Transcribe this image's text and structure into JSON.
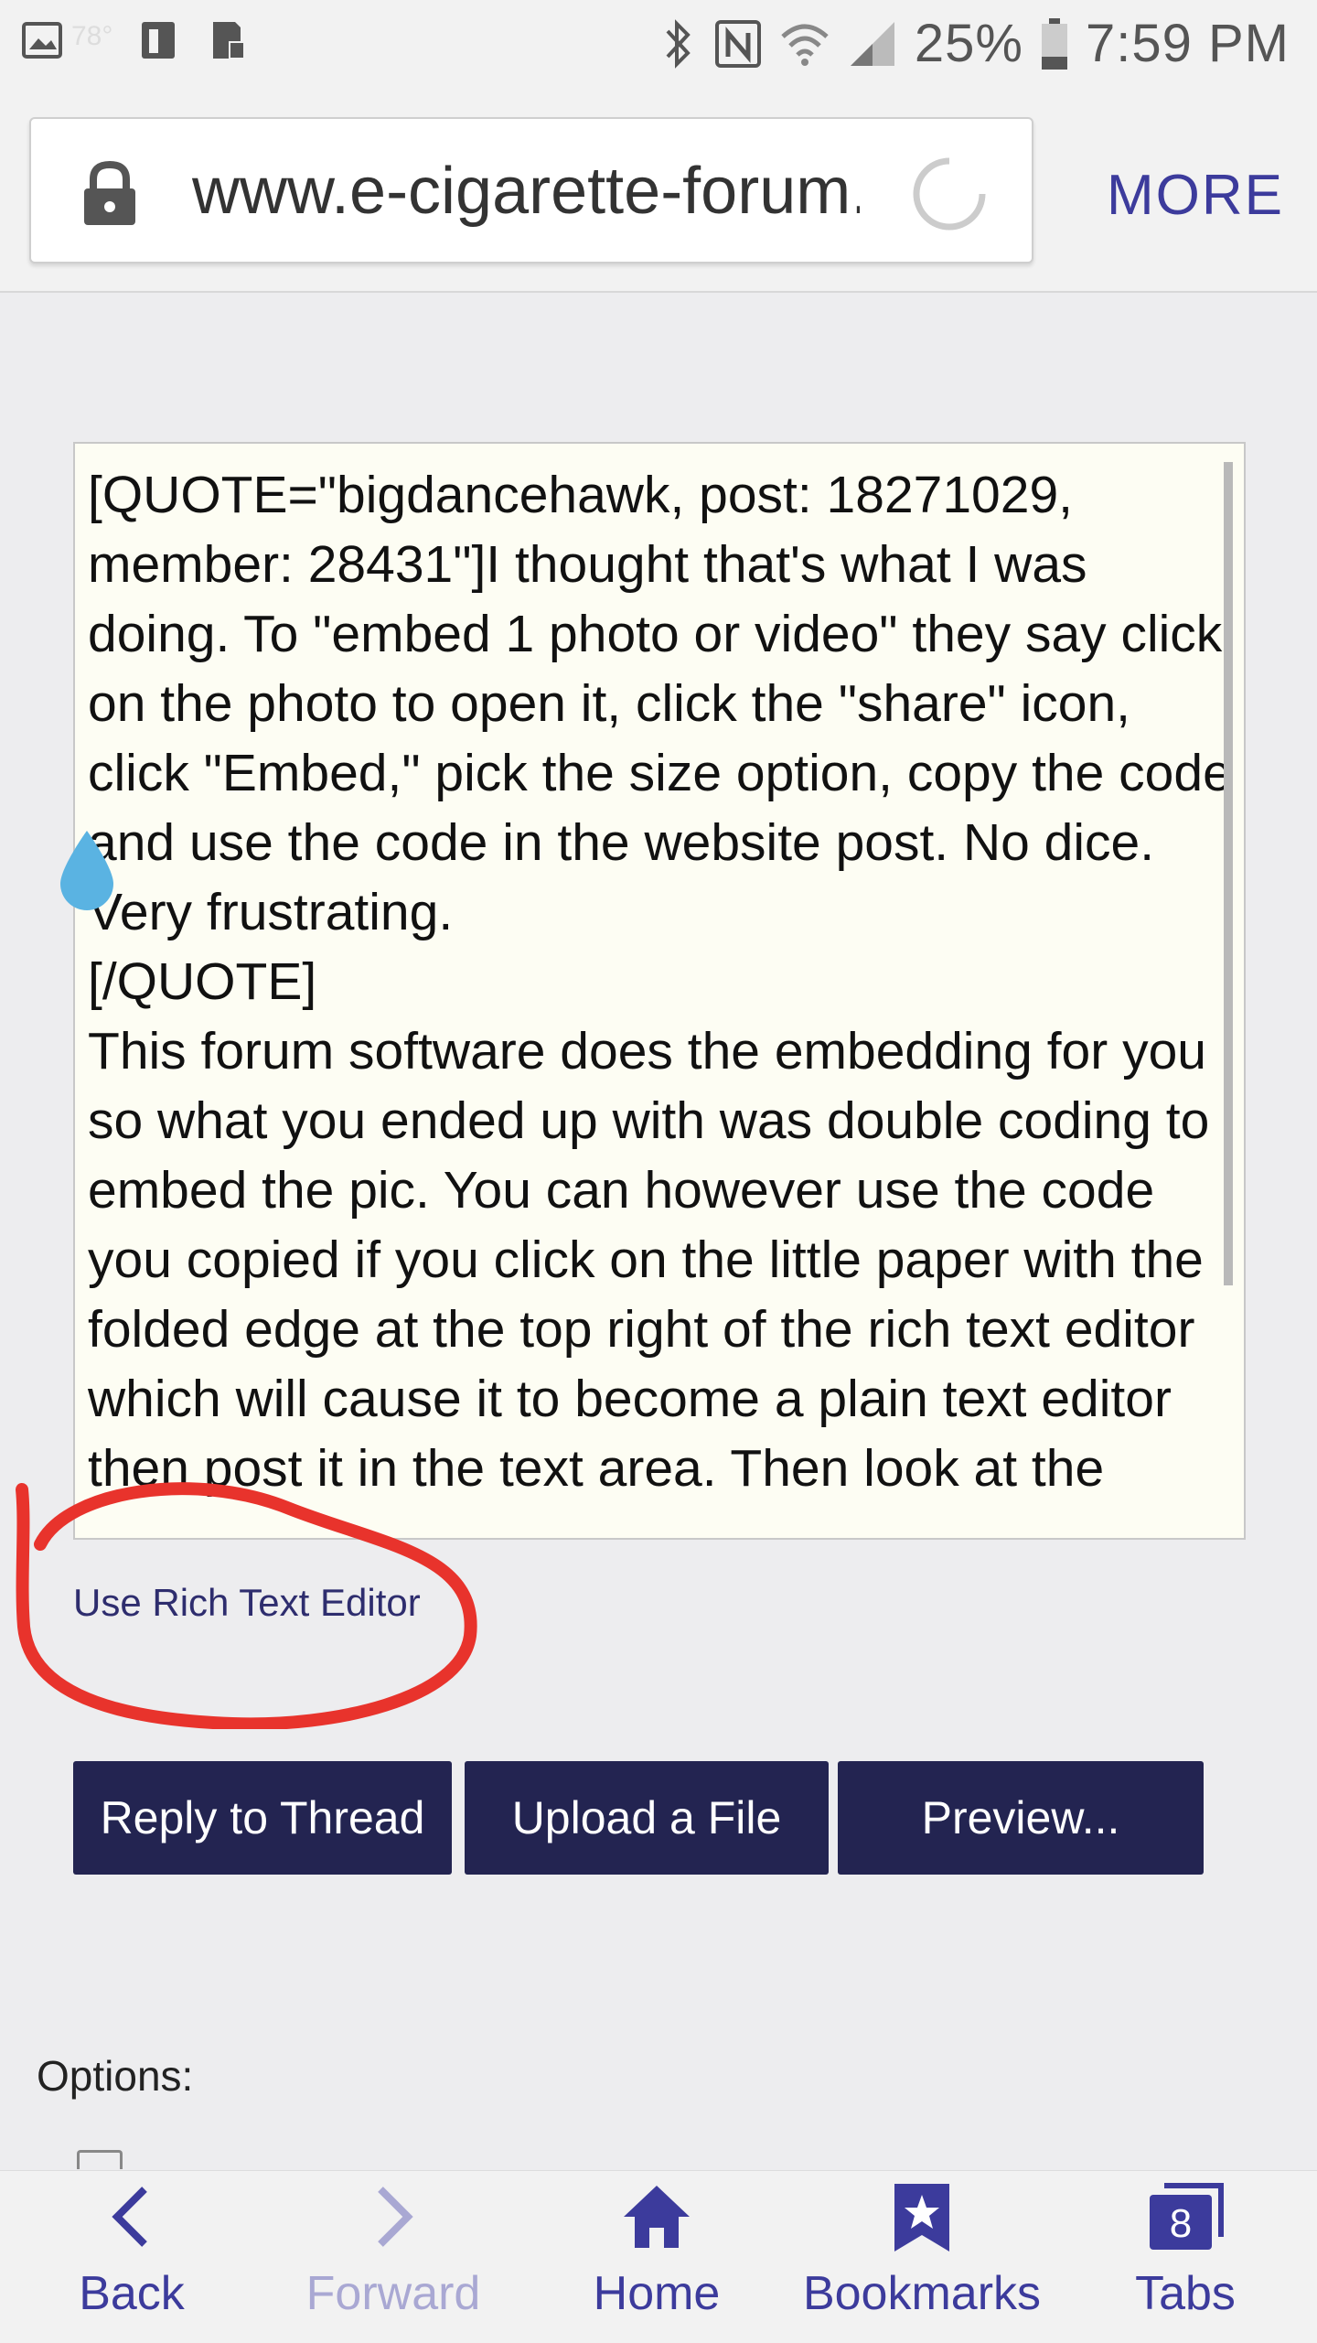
{
  "status_bar": {
    "temperature": "78°",
    "battery_percent": "25%",
    "time": "7:59 PM",
    "icons": [
      "image-icon",
      "app-icon",
      "sd-card-icon",
      "bluetooth-icon",
      "nfc-icon",
      "wifi-icon",
      "signal-icon",
      "battery-icon"
    ]
  },
  "browser": {
    "url": "www.e-cigarette-forum.com",
    "more_label": "MORE"
  },
  "editor": {
    "text": "[QUOTE=\"bigdancehawk, post: 18271029, member: 28431\"]I thought that's what I was doing. To \"embed 1 photo or video\" they say click on the photo to open it, click the \"share\" icon, click \"Embed,\" pick the size option, copy the code and use the code in the website post. No dice. Very frustrating.\n[/QUOTE]\nThis forum software does the embedding for you so what you ended up with was double coding to embed the pic. You can however use the code you copied if you click on the little paper with the folded edge at the top right of the rich text editor which will cause it to become a plain text editor then post it in the text area. Then look at the",
    "rich_text_link": "Use Rich Text Editor",
    "annotation_color": "#e8332c"
  },
  "buttons": {
    "reply": "Reply to Thread",
    "upload": "Upload a File",
    "preview": "Preview..."
  },
  "options": {
    "label": "Options:"
  },
  "bottom_nav": {
    "back": "Back",
    "forward": "Forward",
    "home": "Home",
    "bookmarks": "Bookmarks",
    "tabs": "Tabs",
    "tabs_count": "8"
  },
  "colors": {
    "accent": "#3c3b9c",
    "button_bg": "#232451",
    "editor_bg": "#fdfdf3"
  }
}
